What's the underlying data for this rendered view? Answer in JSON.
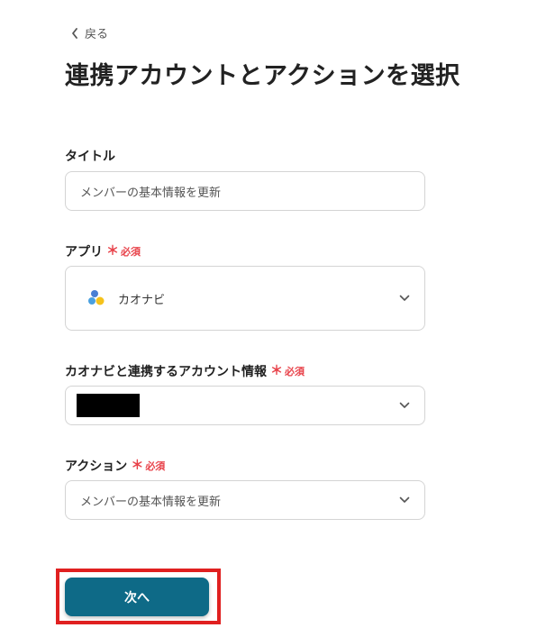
{
  "nav": {
    "back_label": "戻る"
  },
  "page": {
    "title": "連携アカウントとアクションを選択"
  },
  "required_label": "必須",
  "fields": {
    "title": {
      "label": "タイトル",
      "value": "メンバーの基本情報を更新"
    },
    "app": {
      "label": "アプリ",
      "value": "カオナビ"
    },
    "account": {
      "label": "カオナビと連携するアカウント情報"
    },
    "action": {
      "label": "アクション",
      "value": "メンバーの基本情報を更新"
    }
  },
  "buttons": {
    "next_label": "次へ"
  },
  "colors": {
    "primary": "#0e6a87",
    "required": "#e8424a",
    "highlight": "#e02020"
  }
}
